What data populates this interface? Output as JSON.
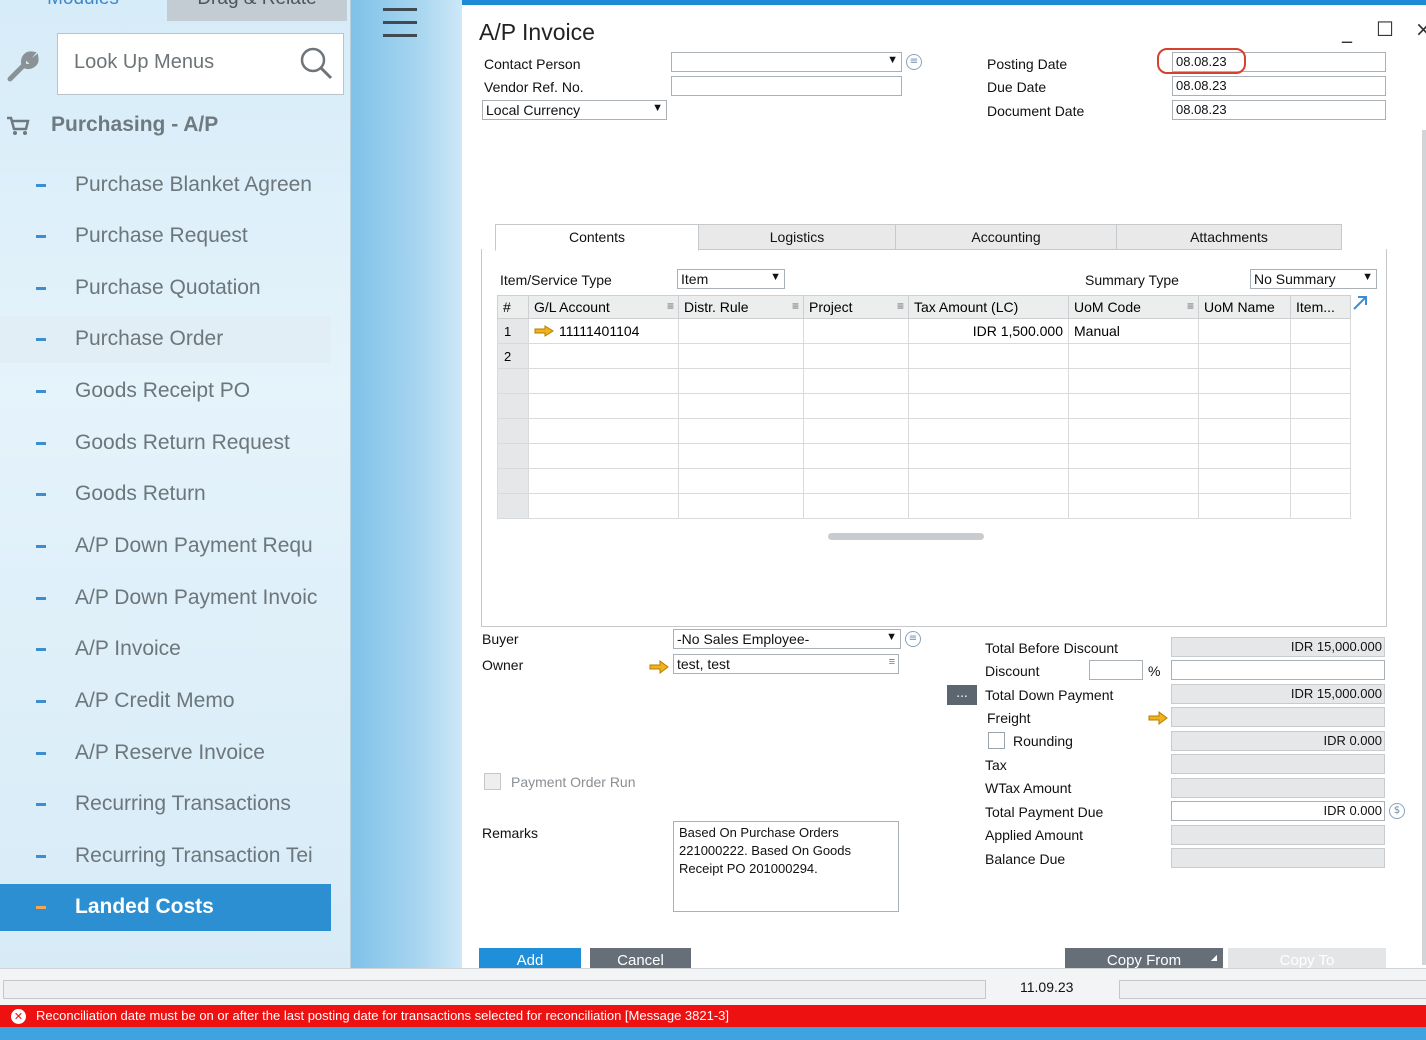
{
  "modules_panel": {
    "tabs": [
      "Modules",
      "Drag & Relate"
    ],
    "search_placeholder": "Look Up Menus",
    "category": "Purchasing - A/P",
    "items": [
      {
        "label": "Purchase Blanket Agreen"
      },
      {
        "label": "Purchase Request"
      },
      {
        "label": "Purchase Quotation"
      },
      {
        "label": "Purchase Order"
      },
      {
        "label": "Goods Receipt PO"
      },
      {
        "label": "Goods Return Request"
      },
      {
        "label": "Goods Return"
      },
      {
        "label": "A/P Down Payment Requ"
      },
      {
        "label": "A/P Down Payment Invoic"
      },
      {
        "label": "A/P Invoice"
      },
      {
        "label": "A/P Credit Memo"
      },
      {
        "label": "A/P Reserve Invoice"
      },
      {
        "label": "Recurring Transactions"
      },
      {
        "label": "Recurring Transaction Tei"
      },
      {
        "label": "Landed Costs"
      }
    ]
  },
  "window": {
    "title": "A/P Invoice",
    "controls": {
      "minimize": "_",
      "maximize": "☐",
      "close": "×"
    }
  },
  "header": {
    "contact_person_label": "Contact Person",
    "contact_person_value": "",
    "vendor_ref_label": "Vendor Ref. No.",
    "vendor_ref_value": "",
    "currency_value": "Local Currency",
    "posting_date_label": "Posting Date",
    "posting_date_value": "08.08.23",
    "due_date_label": "Due Date",
    "due_date_value": "08.08.23",
    "document_date_label": "Document Date",
    "document_date_value": "08.08.23"
  },
  "tabs": [
    "Contents",
    "Logistics",
    "Accounting",
    "Attachments"
  ],
  "contents": {
    "item_service_type_label": "Item/Service Type",
    "item_service_type_value": "Item",
    "summary_type_label": "Summary Type",
    "summary_type_value": "No Summary",
    "columns": [
      "#",
      "G/L Account",
      "Distr. Rule",
      "Project",
      "Tax Amount (LC)",
      "UoM Code",
      "UoM Name",
      "Item..."
    ],
    "rows": [
      {
        "num": "1",
        "gl_account": "11111401104",
        "distr_rule": "",
        "project": "",
        "tax_amount": "IDR 1,500.000",
        "uom_code": "Manual",
        "uom_name": "",
        "item": ""
      },
      {
        "num": "2",
        "gl_account": "",
        "distr_rule": "",
        "project": "",
        "tax_amount": "",
        "uom_code": "",
        "uom_name": "",
        "item": ""
      }
    ]
  },
  "footer": {
    "buyer_label": "Buyer",
    "buyer_value": "-No Sales Employee-",
    "owner_label": "Owner",
    "owner_value": "test, test",
    "payment_order_run_label": "Payment Order Run",
    "remarks_label": "Remarks",
    "remarks_value": "Based On Purchase Orders 221000222. Based On Goods Receipt PO 201000294.",
    "total_before_discount_label": "Total Before Discount",
    "total_before_discount_value": "IDR 15,000.000",
    "discount_label": "Discount",
    "discount_percent": "",
    "discount_percent_sign": "%",
    "discount_value": "",
    "total_down_payment_label": "Total Down Payment",
    "total_down_payment_value": "IDR 15,000.000",
    "freight_label": "Freight",
    "freight_value": "",
    "rounding_label": "Rounding",
    "rounding_value": "IDR 0.000",
    "tax_label": "Tax",
    "tax_value": "",
    "wtax_label": "WTax Amount",
    "wtax_value": "",
    "total_payment_due_label": "Total Payment Due",
    "total_payment_due_value": "IDR 0.000",
    "applied_amount_label": "Applied Amount",
    "applied_amount_value": "",
    "balance_due_label": "Balance Due",
    "balance_due_value": "",
    "ellipsis": "..."
  },
  "buttons": {
    "add": "Add",
    "cancel": "Cancel",
    "copy_from": "Copy From",
    "copy_to": "Copy To"
  },
  "status_bar": {
    "date": "11.09.23",
    "error_message": "Reconciliation date must be on or after the last posting date for transactions selected for reconciliation   [Message 3821-3]"
  },
  "colors": {
    "accent": "#1f8fd9",
    "active_item": "#2b8fd1",
    "error": "#ee1111",
    "highlight": "#d6402e"
  }
}
